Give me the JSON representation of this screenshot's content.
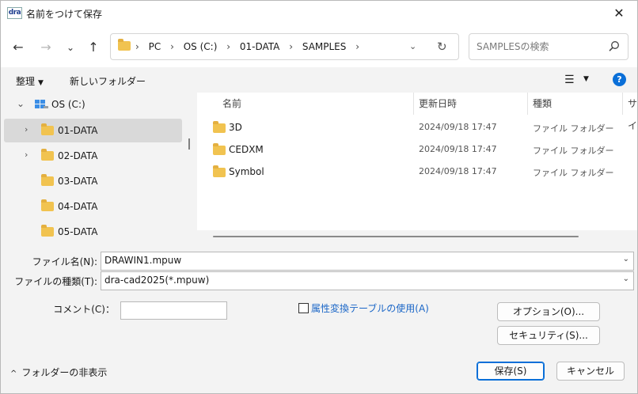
{
  "window": {
    "app_icon": "dra",
    "title": "名前をつけて保存",
    "close_icon": "✕"
  },
  "nav": {
    "back_icon": "←",
    "forward_icon": "→",
    "recent_icon": "⌄",
    "up_icon": "↑",
    "breadcrumbs": [
      "PC",
      "OS (C:)",
      "01-DATA",
      "SAMPLES"
    ],
    "crumb_separator": "›",
    "search_placeholder": "SAMPLESの検索"
  },
  "toolbar": {
    "organize_label": "整理",
    "new_folder_label": "新しいフォルダー",
    "view_icon": "☰",
    "help_icon": "?"
  },
  "tree": {
    "drive_label": "OS (C:)",
    "items": [
      {
        "label": "01-DATA",
        "expandable": true,
        "selected": true
      },
      {
        "label": "02-DATA",
        "expandable": true,
        "selected": false
      },
      {
        "label": "03-DATA",
        "expandable": false,
        "selected": false
      },
      {
        "label": "04-DATA",
        "expandable": false,
        "selected": false
      },
      {
        "label": "05-DATA",
        "expandable": false,
        "selected": false
      }
    ]
  },
  "files": {
    "columns": {
      "name": "名前",
      "date": "更新日時",
      "type": "種類",
      "size": "サイ"
    },
    "rows": [
      {
        "name": "3D",
        "date": "2024/09/18 17:47",
        "type": "ファイル フォルダー"
      },
      {
        "name": "CEDXM",
        "date": "2024/09/18 17:47",
        "type": "ファイル フォルダー"
      },
      {
        "name": "Symbol",
        "date": "2024/09/18 17:47",
        "type": "ファイル フォルダー"
      }
    ]
  },
  "form": {
    "filename_label": "ファイル名(N):",
    "filename_value": "DRAWIN1.mpuw",
    "filetype_label": "ファイルの種類(T):",
    "filetype_value": "dra-cad2025(*.mpuw)",
    "comment_label": "コメント(C)：",
    "comment_value": "",
    "attr_checkbox_label": "属性変換テーブルの使用(A)",
    "attr_checked": false,
    "options_button": "オプション(O)...",
    "security_button": "セキュリティ(S)..."
  },
  "footer": {
    "hide_folders_label": "フォルダーの非表示",
    "save_button": "保存(S)",
    "cancel_button": "キャンセル"
  },
  "colors": {
    "accent": "#0a6fd8",
    "folder": "#f1c350",
    "link": "#1a66c7"
  }
}
